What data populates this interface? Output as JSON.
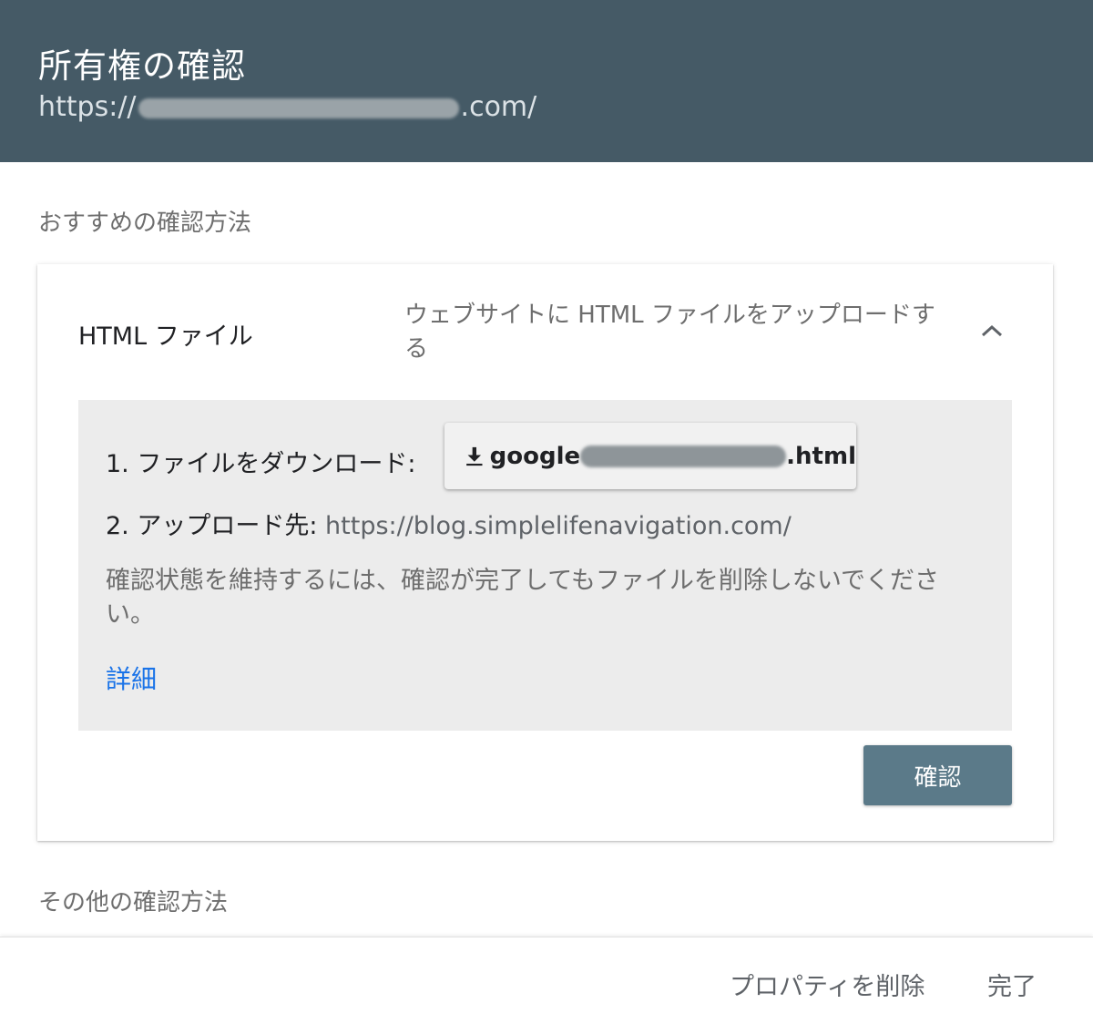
{
  "header": {
    "title": "所有権の確認",
    "url_prefix": "https://",
    "url_suffix": ".com/"
  },
  "recommended_label": "おすすめの確認方法",
  "method": {
    "title": "HTML ファイル",
    "description": "ウェブサイトに HTML ファイルをアップロードする",
    "chevron_icon": "chevron-up-icon"
  },
  "instructions": {
    "step1_label": "1. ファイルをダウンロード:",
    "download_prefix": "google",
    "download_suffix": ".html",
    "download_icon": "download-icon",
    "step2_label": "2. アップロード先:",
    "step2_url": "https://blog.simplelifenavigation.com/",
    "note": "確認状態を維持するには、確認が完了してもファイルを削除しないでください。",
    "details_link": "詳細"
  },
  "confirm_button": "確認",
  "other_label": "その他の確認方法",
  "footer": {
    "remove_property": "プロパティを削除",
    "done": "完了"
  },
  "colors": {
    "header_bg": "#455a66",
    "primary_button": "#5b7a89",
    "link": "#1a73e8",
    "panel_bg": "#ececec"
  }
}
